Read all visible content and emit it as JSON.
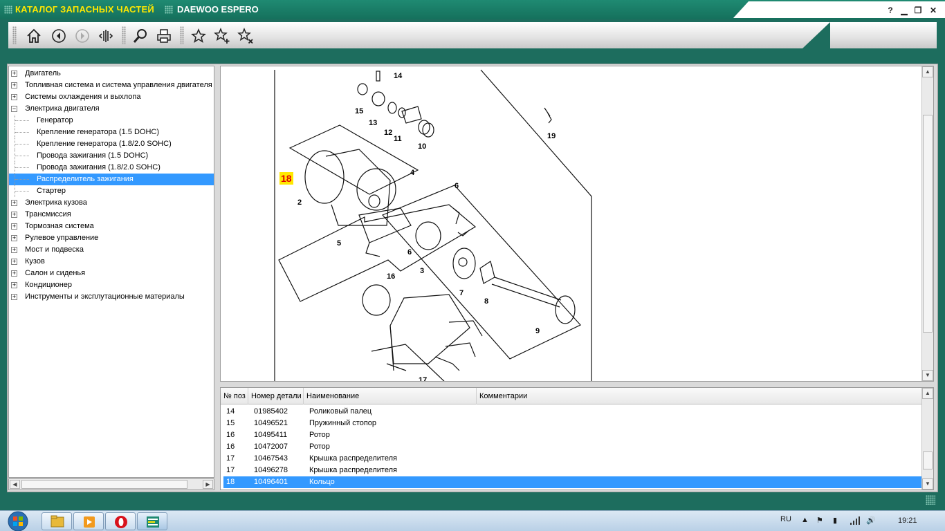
{
  "window": {
    "title_main": "КАТАЛОГ ЗАПАСНЫХ ЧАСТЕЙ",
    "title_sub": "DAEWOO ESPERO",
    "help_label": "?",
    "minimize_label": "▁",
    "restore_label": "❐",
    "close_label": "✕"
  },
  "toolbar": {
    "buttons": [
      "home-icon",
      "back-icon",
      "forward-icon",
      "split-view-icon",
      "search-icon",
      "print-icon",
      "star-icon",
      "star-add-icon",
      "star-remove-icon"
    ]
  },
  "tree": {
    "items": [
      {
        "label": "Двигатель",
        "expander": "+"
      },
      {
        "label": "Топливная система и система управления двигателя",
        "expander": "+"
      },
      {
        "label": "Системы охлаждения и выхлопа",
        "expander": "+"
      },
      {
        "label": "Электрика двигателя",
        "expander": "−"
      },
      {
        "label": "Генератор"
      },
      {
        "label": "Крепление генератора (1.5 DOHC)"
      },
      {
        "label": "Крепление генератора (1.8/2.0 SOHC)"
      },
      {
        "label": "Провода зажигания (1.5 DOHC)"
      },
      {
        "label": "Провода зажигания (1.8/2.0 SOHC)"
      },
      {
        "label": "Распределитель зажигания"
      },
      {
        "label": "Стартер"
      },
      {
        "label": "Электрика кузова",
        "expander": "+"
      },
      {
        "label": "Трансмиссия",
        "expander": "+"
      },
      {
        "label": "Тормозная система",
        "expander": "+"
      },
      {
        "label": "Рулевое управление",
        "expander": "+"
      },
      {
        "label": "Мост и подвеска",
        "expander": "+"
      },
      {
        "label": "Кузов",
        "expander": "+"
      },
      {
        "label": "Салон и сиденья",
        "expander": "+"
      },
      {
        "label": "Кондиционер",
        "expander": "+"
      },
      {
        "label": "Инструменты и эксплутационные материалы",
        "expander": "+"
      }
    ]
  },
  "diagram": {
    "highlighted_callout": "18",
    "callouts": [
      "14",
      "15",
      "13",
      "12",
      "11",
      "10",
      "19",
      "4",
      "2",
      "6",
      "5",
      "6",
      "3",
      "7",
      "8",
      "16",
      "9",
      "17"
    ]
  },
  "table": {
    "headers": [
      "№ поз",
      "Номер детали",
      "Наименование",
      "Комментарии"
    ],
    "rows": [
      {
        "pos": "14",
        "part": "01985402",
        "name": "Роликовый палец",
        "comment": ""
      },
      {
        "pos": "15",
        "part": "10496521",
        "name": "Пружинный стопор",
        "comment": ""
      },
      {
        "pos": "16",
        "part": "10495411",
        "name": "Ротор",
        "comment": ""
      },
      {
        "pos": "16",
        "part": "10472007",
        "name": "Ротор",
        "comment": ""
      },
      {
        "pos": "17",
        "part": "10467543",
        "name": "Крышка распределителя",
        "comment": ""
      },
      {
        "pos": "17",
        "part": "10496278",
        "name": "Крышка распределителя",
        "comment": ""
      },
      {
        "pos": "18",
        "part": "10496401",
        "name": "Кольцо",
        "comment": ""
      }
    ]
  },
  "taskbar": {
    "lang": "RU",
    "clock": "19:21"
  },
  "colors": {
    "window_green": "#1d6d5e",
    "title_yellow": "#ffe800",
    "selection_blue": "#3399ff"
  }
}
